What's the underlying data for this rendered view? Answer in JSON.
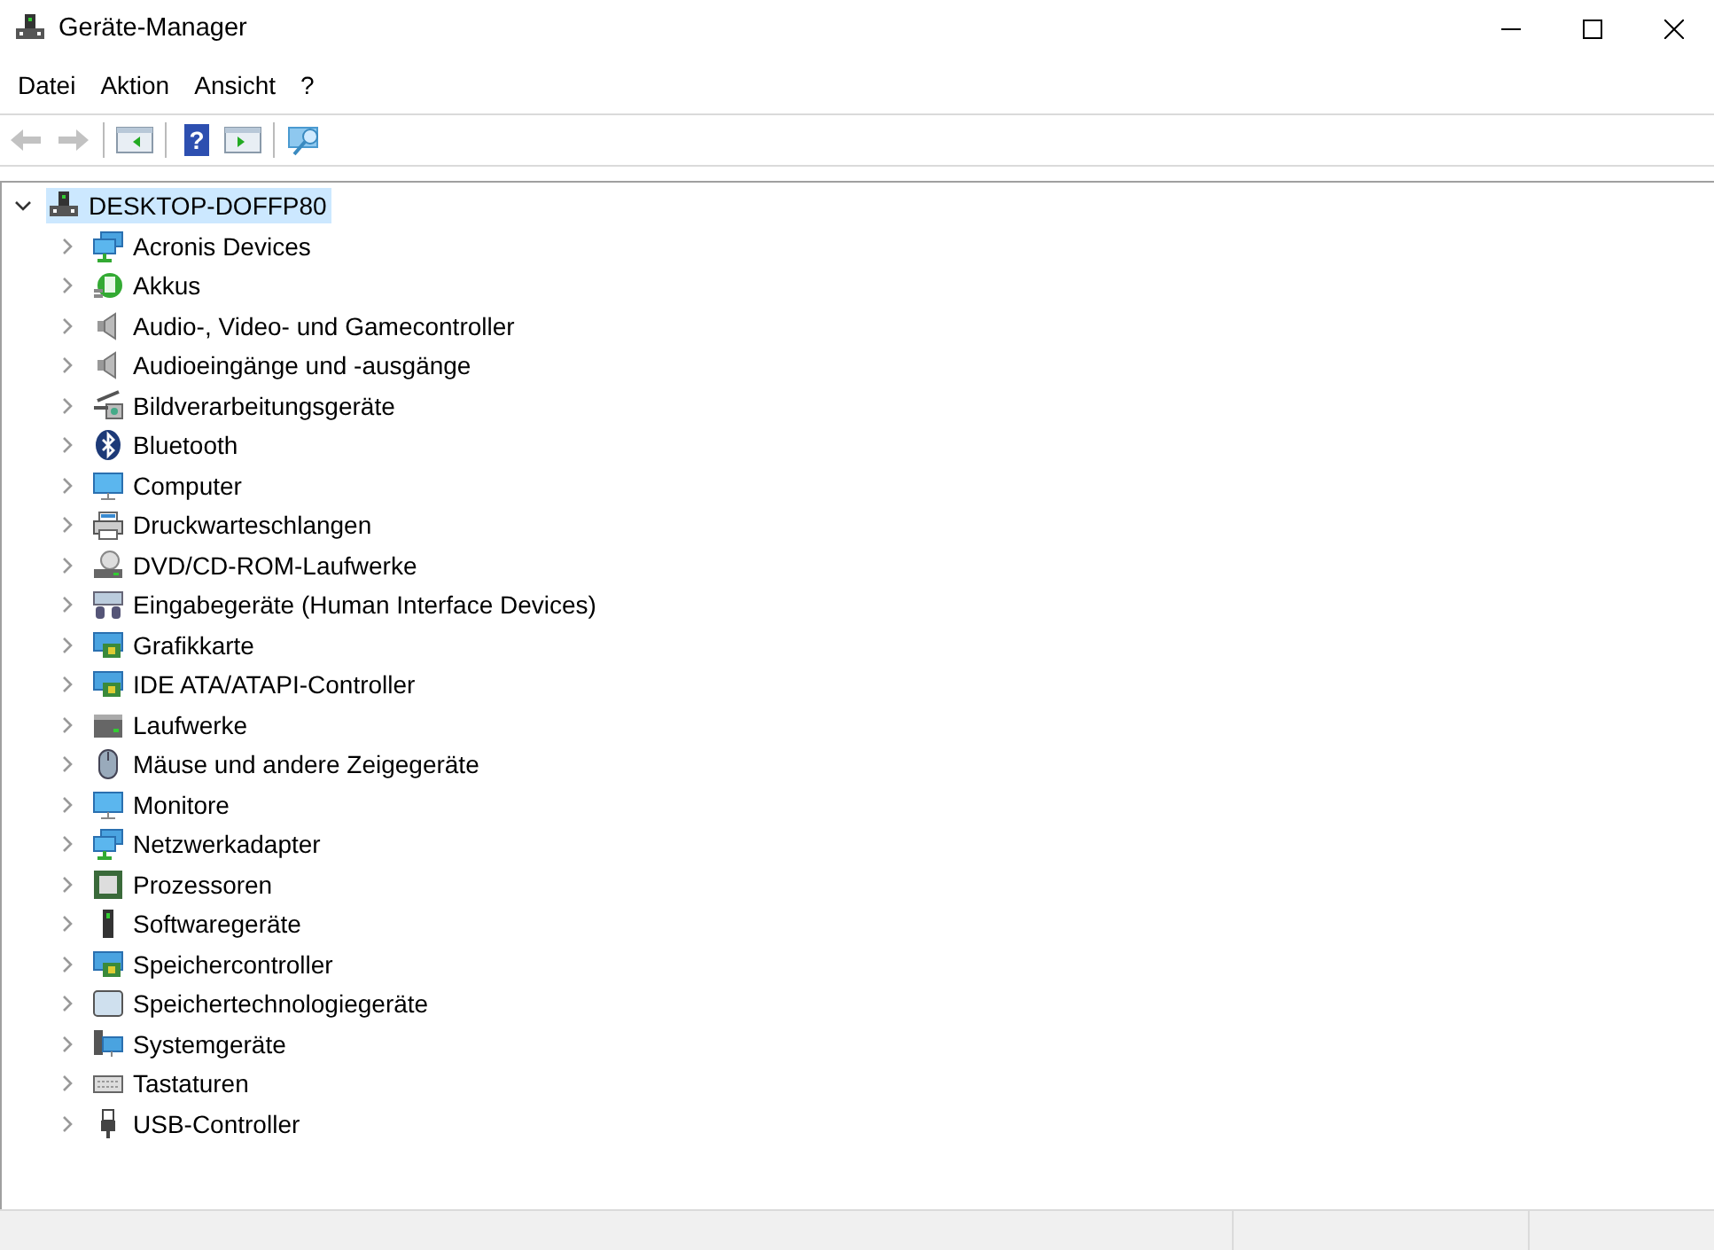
{
  "window": {
    "title": "Geräte-Manager"
  },
  "menu": [
    "Datei",
    "Aktion",
    "Ansicht",
    "?"
  ],
  "toolbar": [
    {
      "kind": "back",
      "disabled": true
    },
    {
      "kind": "forward",
      "disabled": true
    },
    {
      "kind": "sep"
    },
    {
      "kind": "panel-left",
      "disabled": false
    },
    {
      "kind": "sep"
    },
    {
      "kind": "help",
      "glyph": "?",
      "disabled": false
    },
    {
      "kind": "panel-right",
      "disabled": false
    },
    {
      "kind": "sep"
    },
    {
      "kind": "scan",
      "disabled": false
    }
  ],
  "tree": {
    "label": "DESKTOP-DOFFP80",
    "selected": true,
    "expanded": true,
    "children": [
      {
        "label": "Acronis Devices",
        "kind": "network",
        "expanded": false
      },
      {
        "label": "Akkus",
        "kind": "battery",
        "expanded": false
      },
      {
        "label": "Audio-, Video- und Gamecontroller",
        "kind": "speaker",
        "expanded": false
      },
      {
        "label": "Audioeingänge und -ausgänge",
        "kind": "speaker",
        "expanded": false
      },
      {
        "label": "Bildverarbeitungsgeräte",
        "kind": "camera",
        "expanded": false
      },
      {
        "label": "Bluetooth",
        "kind": "bluetooth",
        "expanded": false
      },
      {
        "label": "Computer",
        "kind": "monitor",
        "expanded": false
      },
      {
        "label": "Druckwarteschlangen",
        "kind": "printer",
        "expanded": false
      },
      {
        "label": "DVD/CD-ROM-Laufwerke",
        "kind": "disc",
        "expanded": false
      },
      {
        "label": "Eingabegeräte (Human Interface Devices)",
        "kind": "hid",
        "expanded": false
      },
      {
        "label": "Grafikkarte",
        "kind": "card",
        "expanded": false
      },
      {
        "label": "IDE ATA/ATAPI-Controller",
        "kind": "card",
        "expanded": false
      },
      {
        "label": "Laufwerke",
        "kind": "drive",
        "expanded": false
      },
      {
        "label": "Mäuse und andere Zeigegeräte",
        "kind": "mouse",
        "expanded": false
      },
      {
        "label": "Monitore",
        "kind": "monitor",
        "expanded": false
      },
      {
        "label": "Netzwerkadapter",
        "kind": "network",
        "expanded": false
      },
      {
        "label": "Prozessoren",
        "kind": "cpu",
        "expanded": false
      },
      {
        "label": "Softwaregeräte",
        "kind": "device",
        "expanded": false
      },
      {
        "label": "Speichercontroller",
        "kind": "card",
        "expanded": false
      },
      {
        "label": "Speichertechnologiegeräte",
        "kind": "storage",
        "expanded": false
      },
      {
        "label": "Systemgeräte",
        "kind": "system",
        "expanded": false
      },
      {
        "label": "Tastaturen",
        "kind": "keyboard",
        "expanded": false
      },
      {
        "label": "USB-Controller",
        "kind": "usb",
        "expanded": false
      }
    ]
  }
}
